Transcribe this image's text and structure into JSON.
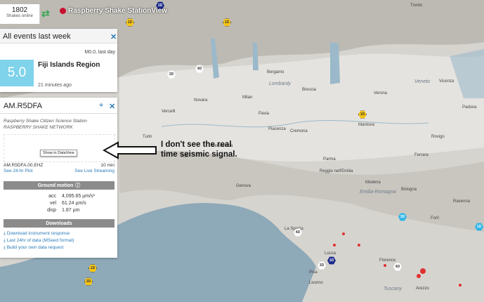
{
  "topbar": {
    "shake_count": "1802",
    "shake_label": "Shakes online",
    "brand": "Raspberry Shake StationView"
  },
  "events_card": {
    "title": "All events last week",
    "mag_note": "M0.0, last day",
    "magnitude": "5.0",
    "region": "Fiji Islands Region",
    "ago": "21 minutes ago"
  },
  "station_card": {
    "title": "AM.R5DFA",
    "subtitle1": "Raspberry Shake Citizen Science Station",
    "subtitle2": "RASPBERRY SHAKE NETWORK",
    "tooltip": "Show in DataView",
    "channel": "AM.R5DFA.00.EHZ",
    "window": "10 min",
    "plot_link": "See 24-hr Plot",
    "live_link": "See Live Streaming",
    "ground_motion_header": "Ground motion",
    "acc_label": "acc",
    "acc_value": "4,095.65 µm/s²",
    "vel_label": "vel",
    "vel_value": "61.24 µm/s",
    "disp_label": "disp",
    "disp_value": "1.87 µm",
    "downloads_header": "Downloads",
    "downloads": [
      "Download instrument response",
      "Last 24hr of data (MSeed format)",
      "Build your own data request"
    ]
  },
  "annotation": "I don't see the real time seismic signal.",
  "map": {
    "cities": {
      "milano": "Milan",
      "novara": "Novara",
      "vercelli": "Vercelli",
      "bergamo": "Bergamo",
      "brescia": "Brescia",
      "verona": "Verona",
      "vicenza": "Vicenza",
      "trento": "Trento",
      "piacenza": "Piacenza",
      "cremona": "Cremona",
      "mantova": "Mantova",
      "parma": "Parma",
      "modena": "Modena",
      "bologna": "Bologna",
      "ferrara": "Ferrara",
      "rovigo": "Rovigo",
      "padova": "Padova",
      "alessandria": "Alessandria",
      "genova": "Genova",
      "asti": "Asti",
      "torino": "Turin",
      "pavia": "Pavia",
      "firenze": "Florence",
      "pisa": "Pisa",
      "lucca": "Lucca",
      "livorno": "Livorno",
      "arezzo": "Arezzo",
      "forli": "Forlì",
      "ravenna": "Ravenna",
      "reggio": "Reggio nell'Emilia",
      "spezia": "La Spezia"
    },
    "regions": {
      "lombardy": "Lombardy",
      "veneto": "Veneto",
      "emilia": "Emilia-Romagna",
      "tuscany": "Tuscany"
    },
    "markers": [
      "1D",
      "1D",
      "1D",
      "4D",
      "3D",
      "4D",
      "1D",
      "1D",
      "3D",
      "3D",
      "4D",
      "1D",
      "3D",
      "1D"
    ]
  },
  "colors": {
    "accent": "#2b7bb9",
    "magnitude_box": "#7fd3ea",
    "section_header": "#8b8b8b"
  }
}
